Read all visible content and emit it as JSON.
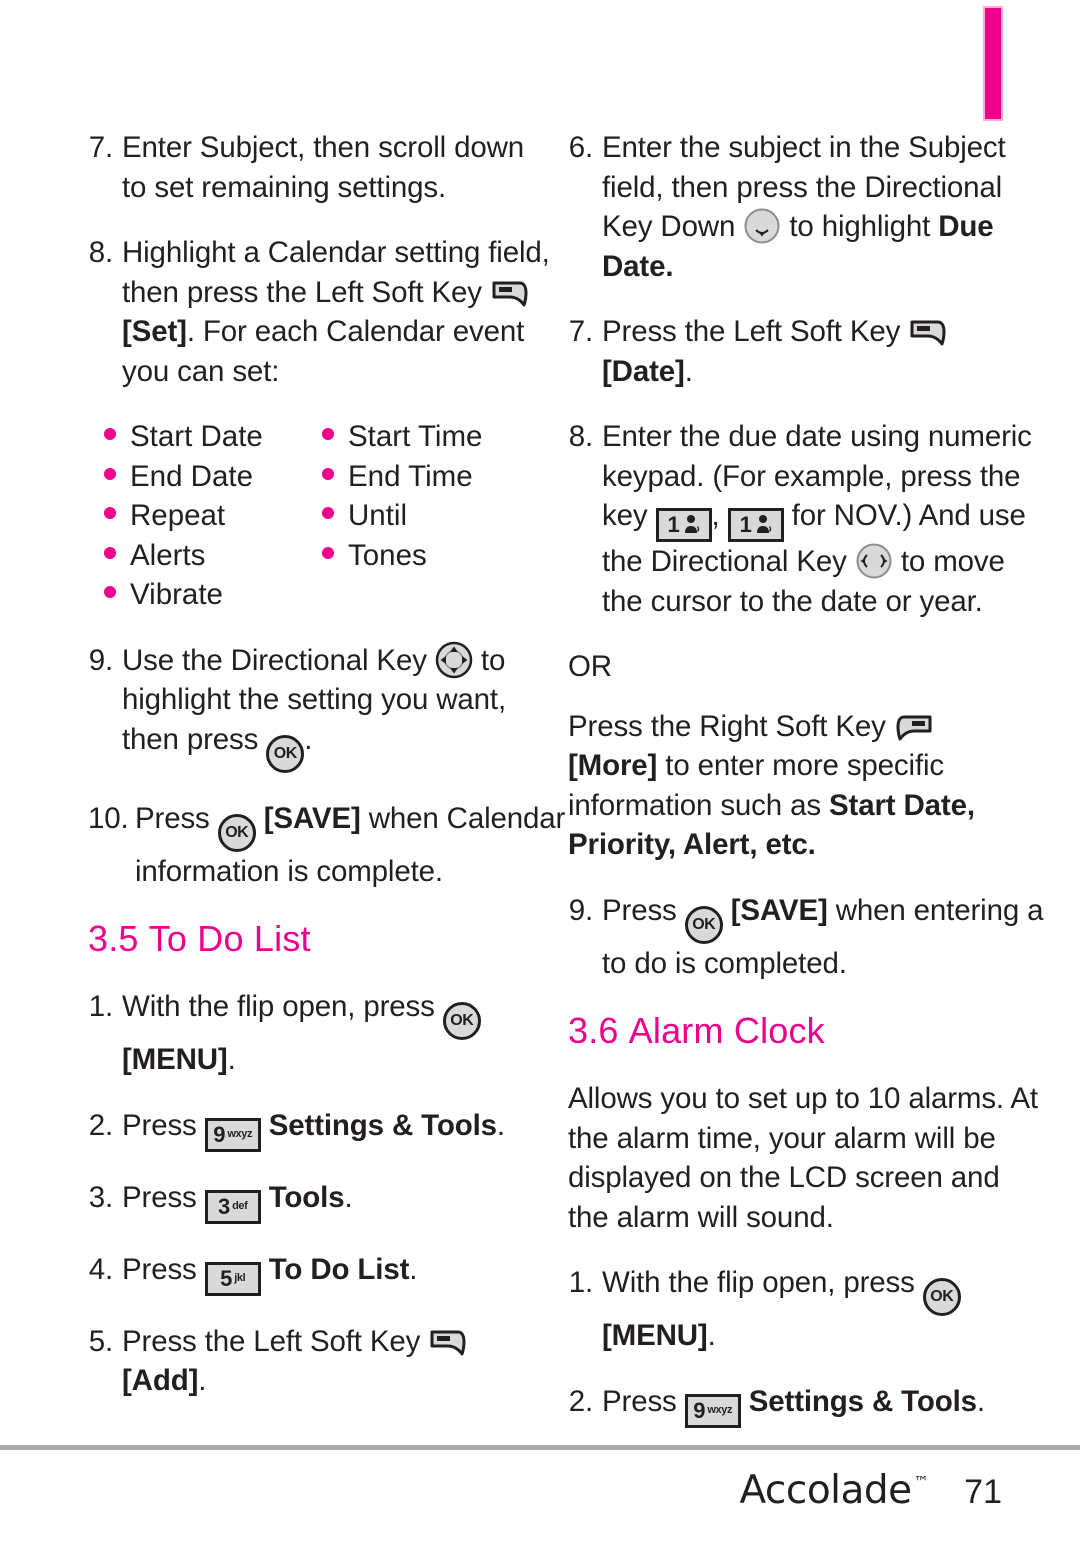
{
  "page": {
    "number": "71",
    "brand": "Accolade",
    "trademark": "™",
    "accent_color": "#ec008c",
    "tab_marker_color": "#ec008c"
  },
  "icons": {
    "left_soft_key": "left-soft-key-icon",
    "right_soft_key": "right-soft-key-icon",
    "ok_key": "OK",
    "directional_key": "directional-key-icon",
    "directional_key_down": "directional-key-down-icon",
    "directional_key_leftright": "directional-key-leftright-icon",
    "key_1": {
      "digit": "1",
      "letters": ""
    },
    "key_3": {
      "digit": "3",
      "letters": "def"
    },
    "key_5": {
      "digit": "5",
      "letters": "jkl"
    },
    "key_9": {
      "digit": "9",
      "letters": "wxyz"
    }
  },
  "left_column": {
    "step7": {
      "num": "7.",
      "line1": "Enter Subject, then scroll down",
      "line2": "to set remaining settings."
    },
    "step8": {
      "num": "8.",
      "t1": "Highlight a Calendar setting field, then press the Left Soft Key ",
      "t2": "[Set]",
      "t3": ". For each Calendar event you can set:"
    },
    "bullets_col1": [
      "Start Date",
      "End Date",
      "Repeat",
      "Alerts",
      "Vibrate"
    ],
    "bullets_col2": [
      "Start Time",
      "End Time",
      "Until",
      "Tones"
    ],
    "step9": {
      "num": "9.",
      "t1": "Use the Directional Key ",
      "t2": " to highlight the setting you want, then press ",
      "t3": "."
    },
    "step10": {
      "num": "10.",
      "t1": "Press ",
      "t2": "[SAVE]",
      "t3": " when Calendar information is complete."
    },
    "heading": {
      "number": "3.5",
      "title": "To Do List"
    },
    "todo_step1": {
      "num": "1.",
      "t1": "With the flip open, press ",
      "t2": "[MENU]",
      "t3": "."
    },
    "todo_step2": {
      "num": "2.",
      "t1": "Press ",
      "t2": "Settings & Tools",
      "t3": "."
    },
    "todo_step3": {
      "num": "3.",
      "t1": "Press ",
      "t2": "Tools",
      "t3": "."
    },
    "todo_step4": {
      "num": "4.",
      "t1": "Press ",
      "t2": "To Do List",
      "t3": "."
    },
    "todo_step5": {
      "num": "5.",
      "t1": "Press the Left Soft Key ",
      "t2": "[Add]",
      "t3": "."
    }
  },
  "right_column": {
    "step6": {
      "num": "6.",
      "t1": "Enter the subject in the Subject field, then press the Directional Key Down ",
      "t2": " to highlight ",
      "t3": "Due Date",
      "t4": "."
    },
    "step7": {
      "num": "7.",
      "t1": "Press the Left Soft Key ",
      "t2": "[Date]",
      "t3": "."
    },
    "step8": {
      "num": "8.",
      "t1": "Enter the due date using numeric keypad. (For example, press the key ",
      "t2": ", ",
      "t3": " for NOV.) And use the Directional Key ",
      "t4": " to move the cursor to the date or year."
    },
    "or_label": "OR",
    "or_para": {
      "t1": "Press the Right Soft Key ",
      "t2": "[More]",
      "t3": " to enter more specific information such as ",
      "t4": "Start Date, Priority, Alert, etc."
    },
    "step9": {
      "num": "9.",
      "t1": "Press ",
      "t2": "[SAVE]",
      "t3": " when entering a to do is completed."
    },
    "heading": {
      "number": "3.6",
      "title": "Alarm Clock"
    },
    "alarm_desc": "Allows you to set up to 10 alarms. At the alarm time, your alarm will be displayed on the LCD screen and the alarm will sound.",
    "alarm_step1": {
      "num": "1.",
      "t1": "With the flip open, press ",
      "t2": "[MENU]",
      "t3": "."
    },
    "alarm_step2": {
      "num": "2.",
      "t1": "Press ",
      "t2": "Settings & Tools",
      "t3": "."
    }
  }
}
